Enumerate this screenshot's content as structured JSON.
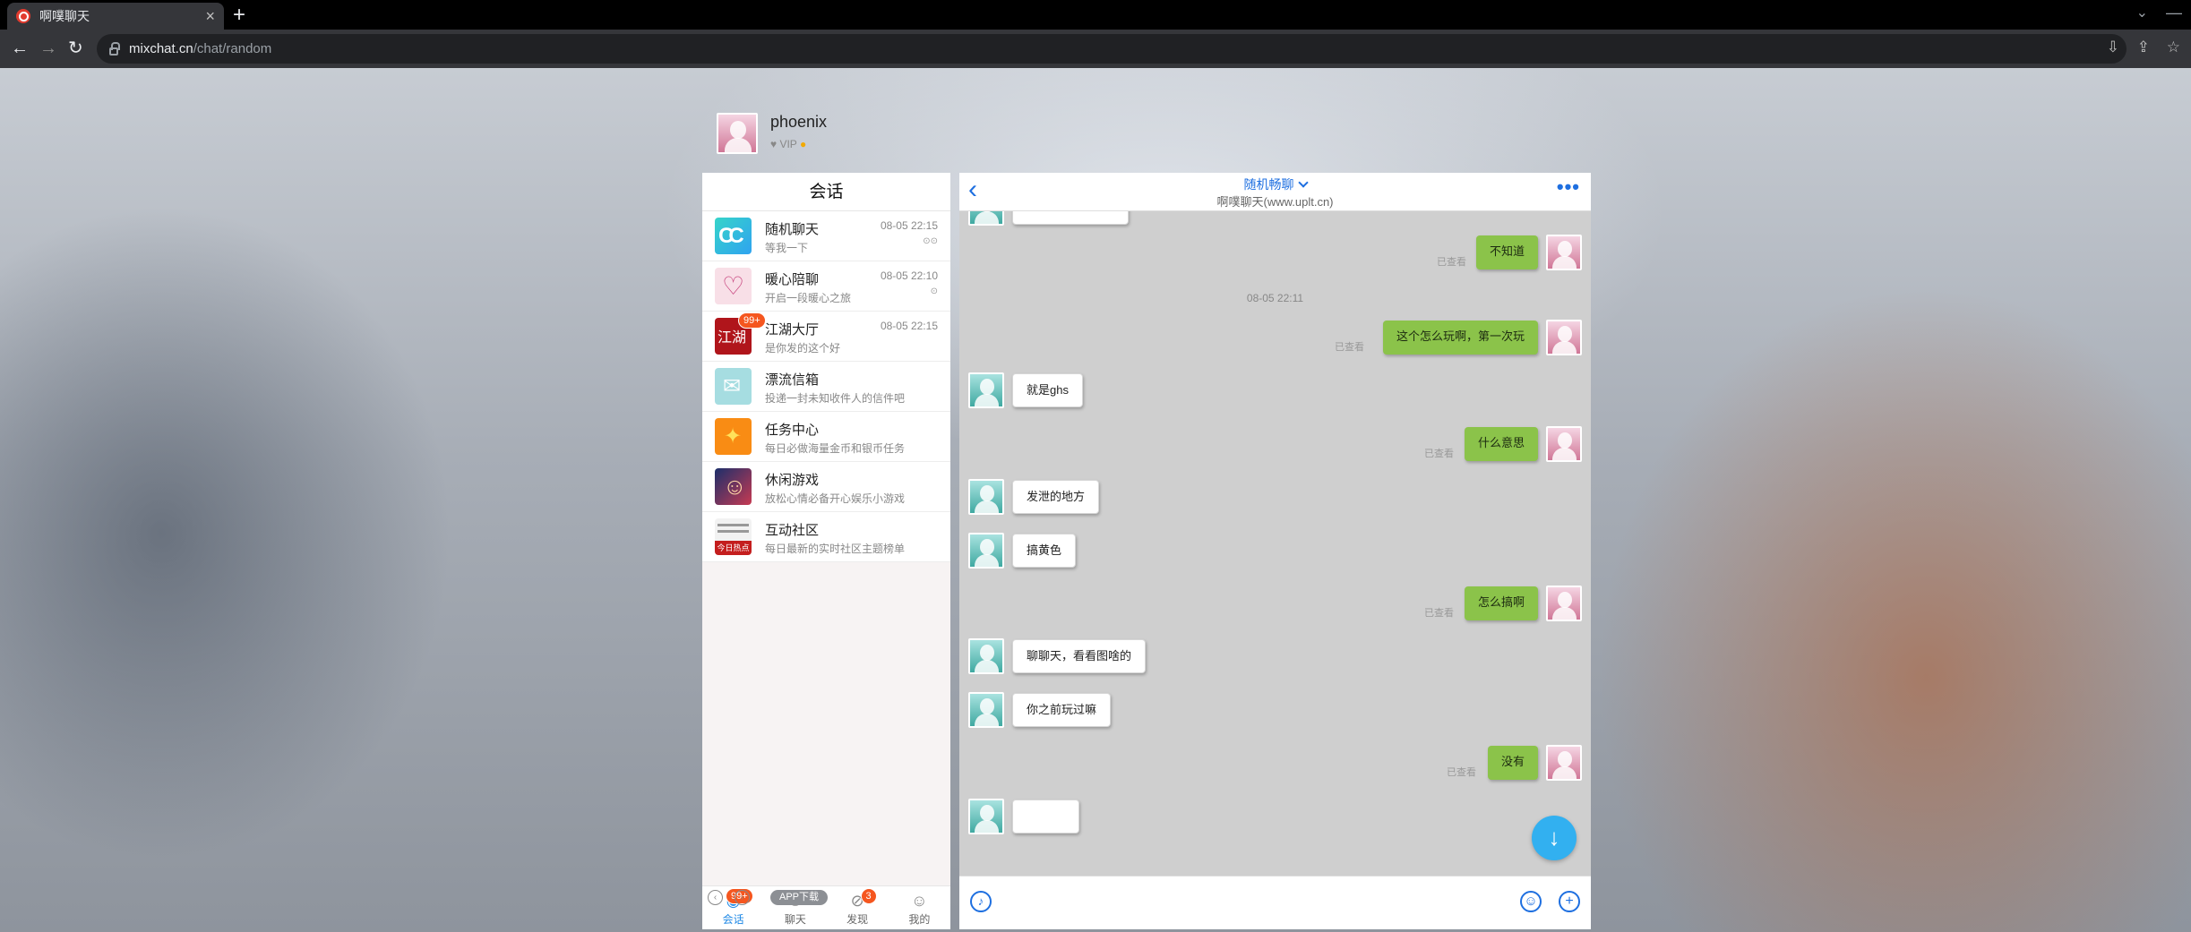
{
  "browser": {
    "tab_title": "啊噗聊天",
    "tab_close": "×",
    "new_tab": "+",
    "url_host": "mixchat.cn",
    "url_path": "/chat/random"
  },
  "profile": {
    "name": "phoenix",
    "level": "VIP"
  },
  "left_panel": {
    "title": "会话",
    "conversations": [
      {
        "name": "随机聊天",
        "sub": "等我一下",
        "time": "08-05 22:15",
        "status": "⊙⊙",
        "icon": "random-chat-icon"
      },
      {
        "name": "暖心陪聊",
        "sub": "开启一段暖心之旅",
        "time": "08-05 22:10",
        "status": "⊙",
        "icon": "warm-chat-icon"
      },
      {
        "name": "江湖大厅",
        "sub": "是你发的这个好",
        "time": "08-05 22:15",
        "badge": "99+",
        "icon": "jianghu-hall-icon"
      },
      {
        "name": "漂流信箱",
        "sub": "投递一封未知收件人的信件吧",
        "icon": "drift-mailbox-icon"
      },
      {
        "name": "任务中心",
        "sub": "每日必做海量金币和银币任务",
        "icon": "task-center-icon"
      },
      {
        "name": "休闲游戏",
        "sub": "放松心情必备开心娱乐小游戏",
        "icon": "casual-game-icon"
      },
      {
        "name": "互动社区",
        "sub": "每日最新的实时社区主题榜单",
        "icon": "community-icon",
        "icon_text": "今日热点"
      }
    ],
    "nav": [
      {
        "label": "会话",
        "badge": "99+",
        "icon": "chat-bubble-icon"
      },
      {
        "label": "聊天",
        "icon": "friends-icon"
      },
      {
        "label": "发现",
        "badge": "3",
        "icon": "compass-icon"
      },
      {
        "label": "我的",
        "icon": "person-icon"
      }
    ]
  },
  "chat": {
    "title": "随机畅聊",
    "subtitle": "啊噗聊天(www.uplt.cn)",
    "more": "•••",
    "timestamp": "08-05 22:11",
    "read_label": "已查看",
    "messages": [
      {
        "from": "me",
        "text": "不知道",
        "read": true
      },
      {
        "from": "me",
        "text": "这个怎么玩啊，第一次玩",
        "read": true
      },
      {
        "from": "other",
        "text": "就是ghs"
      },
      {
        "from": "me",
        "text": "什么意思",
        "read": true
      },
      {
        "from": "other",
        "text": "发泄的地方"
      },
      {
        "from": "other",
        "text": "搞黄色"
      },
      {
        "from": "me",
        "text": "怎么搞啊",
        "read": true
      },
      {
        "from": "other",
        "text": "聊聊天，看看图啥的"
      },
      {
        "from": "other",
        "text": "你之前玩过嘛"
      },
      {
        "from": "me",
        "text": "没有",
        "read": true
      }
    ]
  },
  "footer": {
    "app_download": "APP下载"
  },
  "colors": {
    "accent": "#1e6fe0",
    "my_bubble": "#8bc34a",
    "badge": "#f5561f"
  }
}
